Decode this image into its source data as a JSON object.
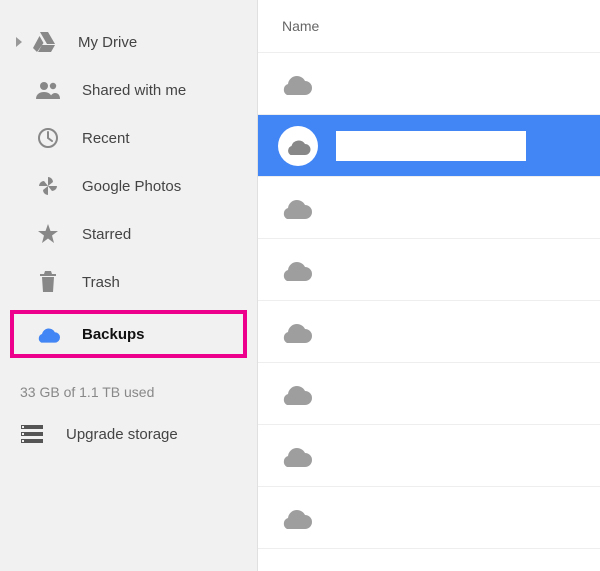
{
  "sidebar": {
    "items": [
      {
        "label": "My Drive"
      },
      {
        "label": "Shared with me"
      },
      {
        "label": "Recent"
      },
      {
        "label": "Google Photos"
      },
      {
        "label": "Starred"
      },
      {
        "label": "Trash"
      },
      {
        "label": "Backups"
      }
    ],
    "storage_text": "33 GB of 1.1 TB used",
    "upgrade_label": "Upgrade storage"
  },
  "main": {
    "column_header": "Name",
    "rows": [
      {
        "selected": false
      },
      {
        "selected": true
      },
      {
        "selected": false
      },
      {
        "selected": false
      },
      {
        "selected": false
      },
      {
        "selected": false
      },
      {
        "selected": false
      },
      {
        "selected": false
      }
    ]
  },
  "colors": {
    "accent_blue": "#4285f4",
    "highlight_pink": "#ec008c",
    "icon_gray": "#888888"
  }
}
